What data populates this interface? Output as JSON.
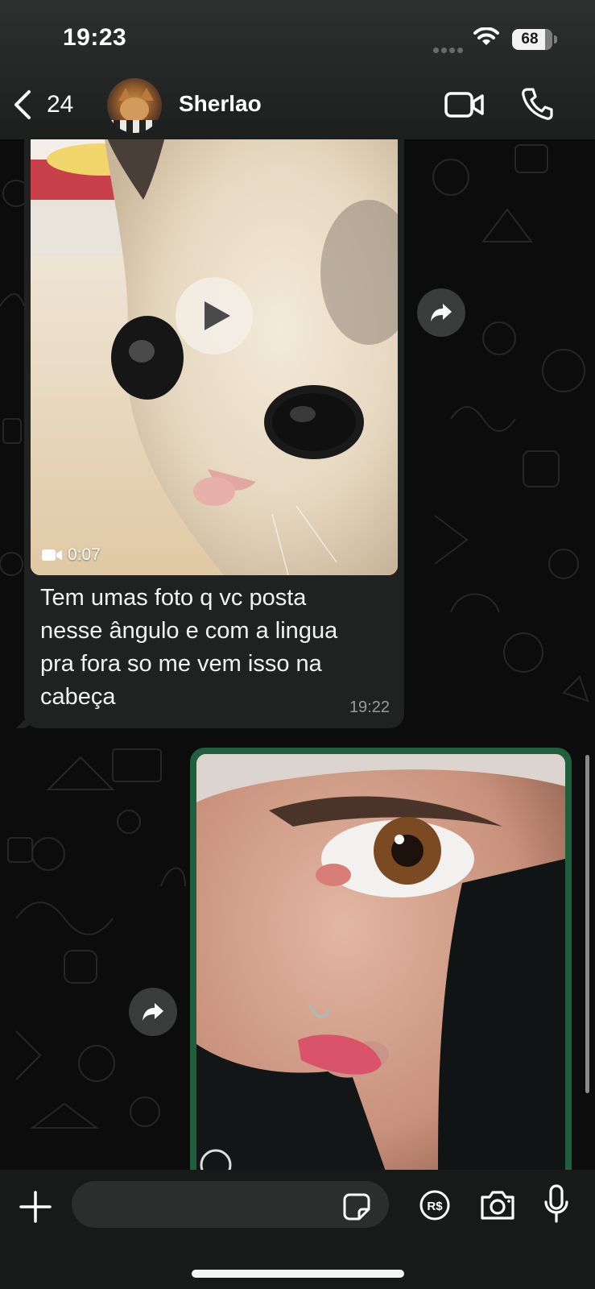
{
  "status_bar": {
    "time": "19:23",
    "battery": "68"
  },
  "header": {
    "back_count": "24",
    "contact_name": "Sherlao",
    "icons": [
      "chevron-left-icon",
      "video-camera-icon",
      "phone-icon"
    ]
  },
  "messages": [
    {
      "direction": "incoming",
      "type": "video",
      "duration": "0:07",
      "text": "Tem umas foto q vc posta\nnesse ângulo e com a lingua\npra fora so me vem isso na\ncabeça",
      "time": "19:22"
    },
    {
      "direction": "outgoing",
      "type": "photo"
    }
  ],
  "input_bar": {
    "placeholder": "",
    "icons": [
      "plus-icon",
      "sticker-icon",
      "payment-icon",
      "camera-icon",
      "microphone-icon"
    ],
    "payment_label": "R$"
  },
  "colors": {
    "header_bg": "#262928",
    "incoming_bubble": "#202222",
    "outgoing_bubble": "#1f5f3e",
    "chat_bg": "#0c0c0c"
  }
}
